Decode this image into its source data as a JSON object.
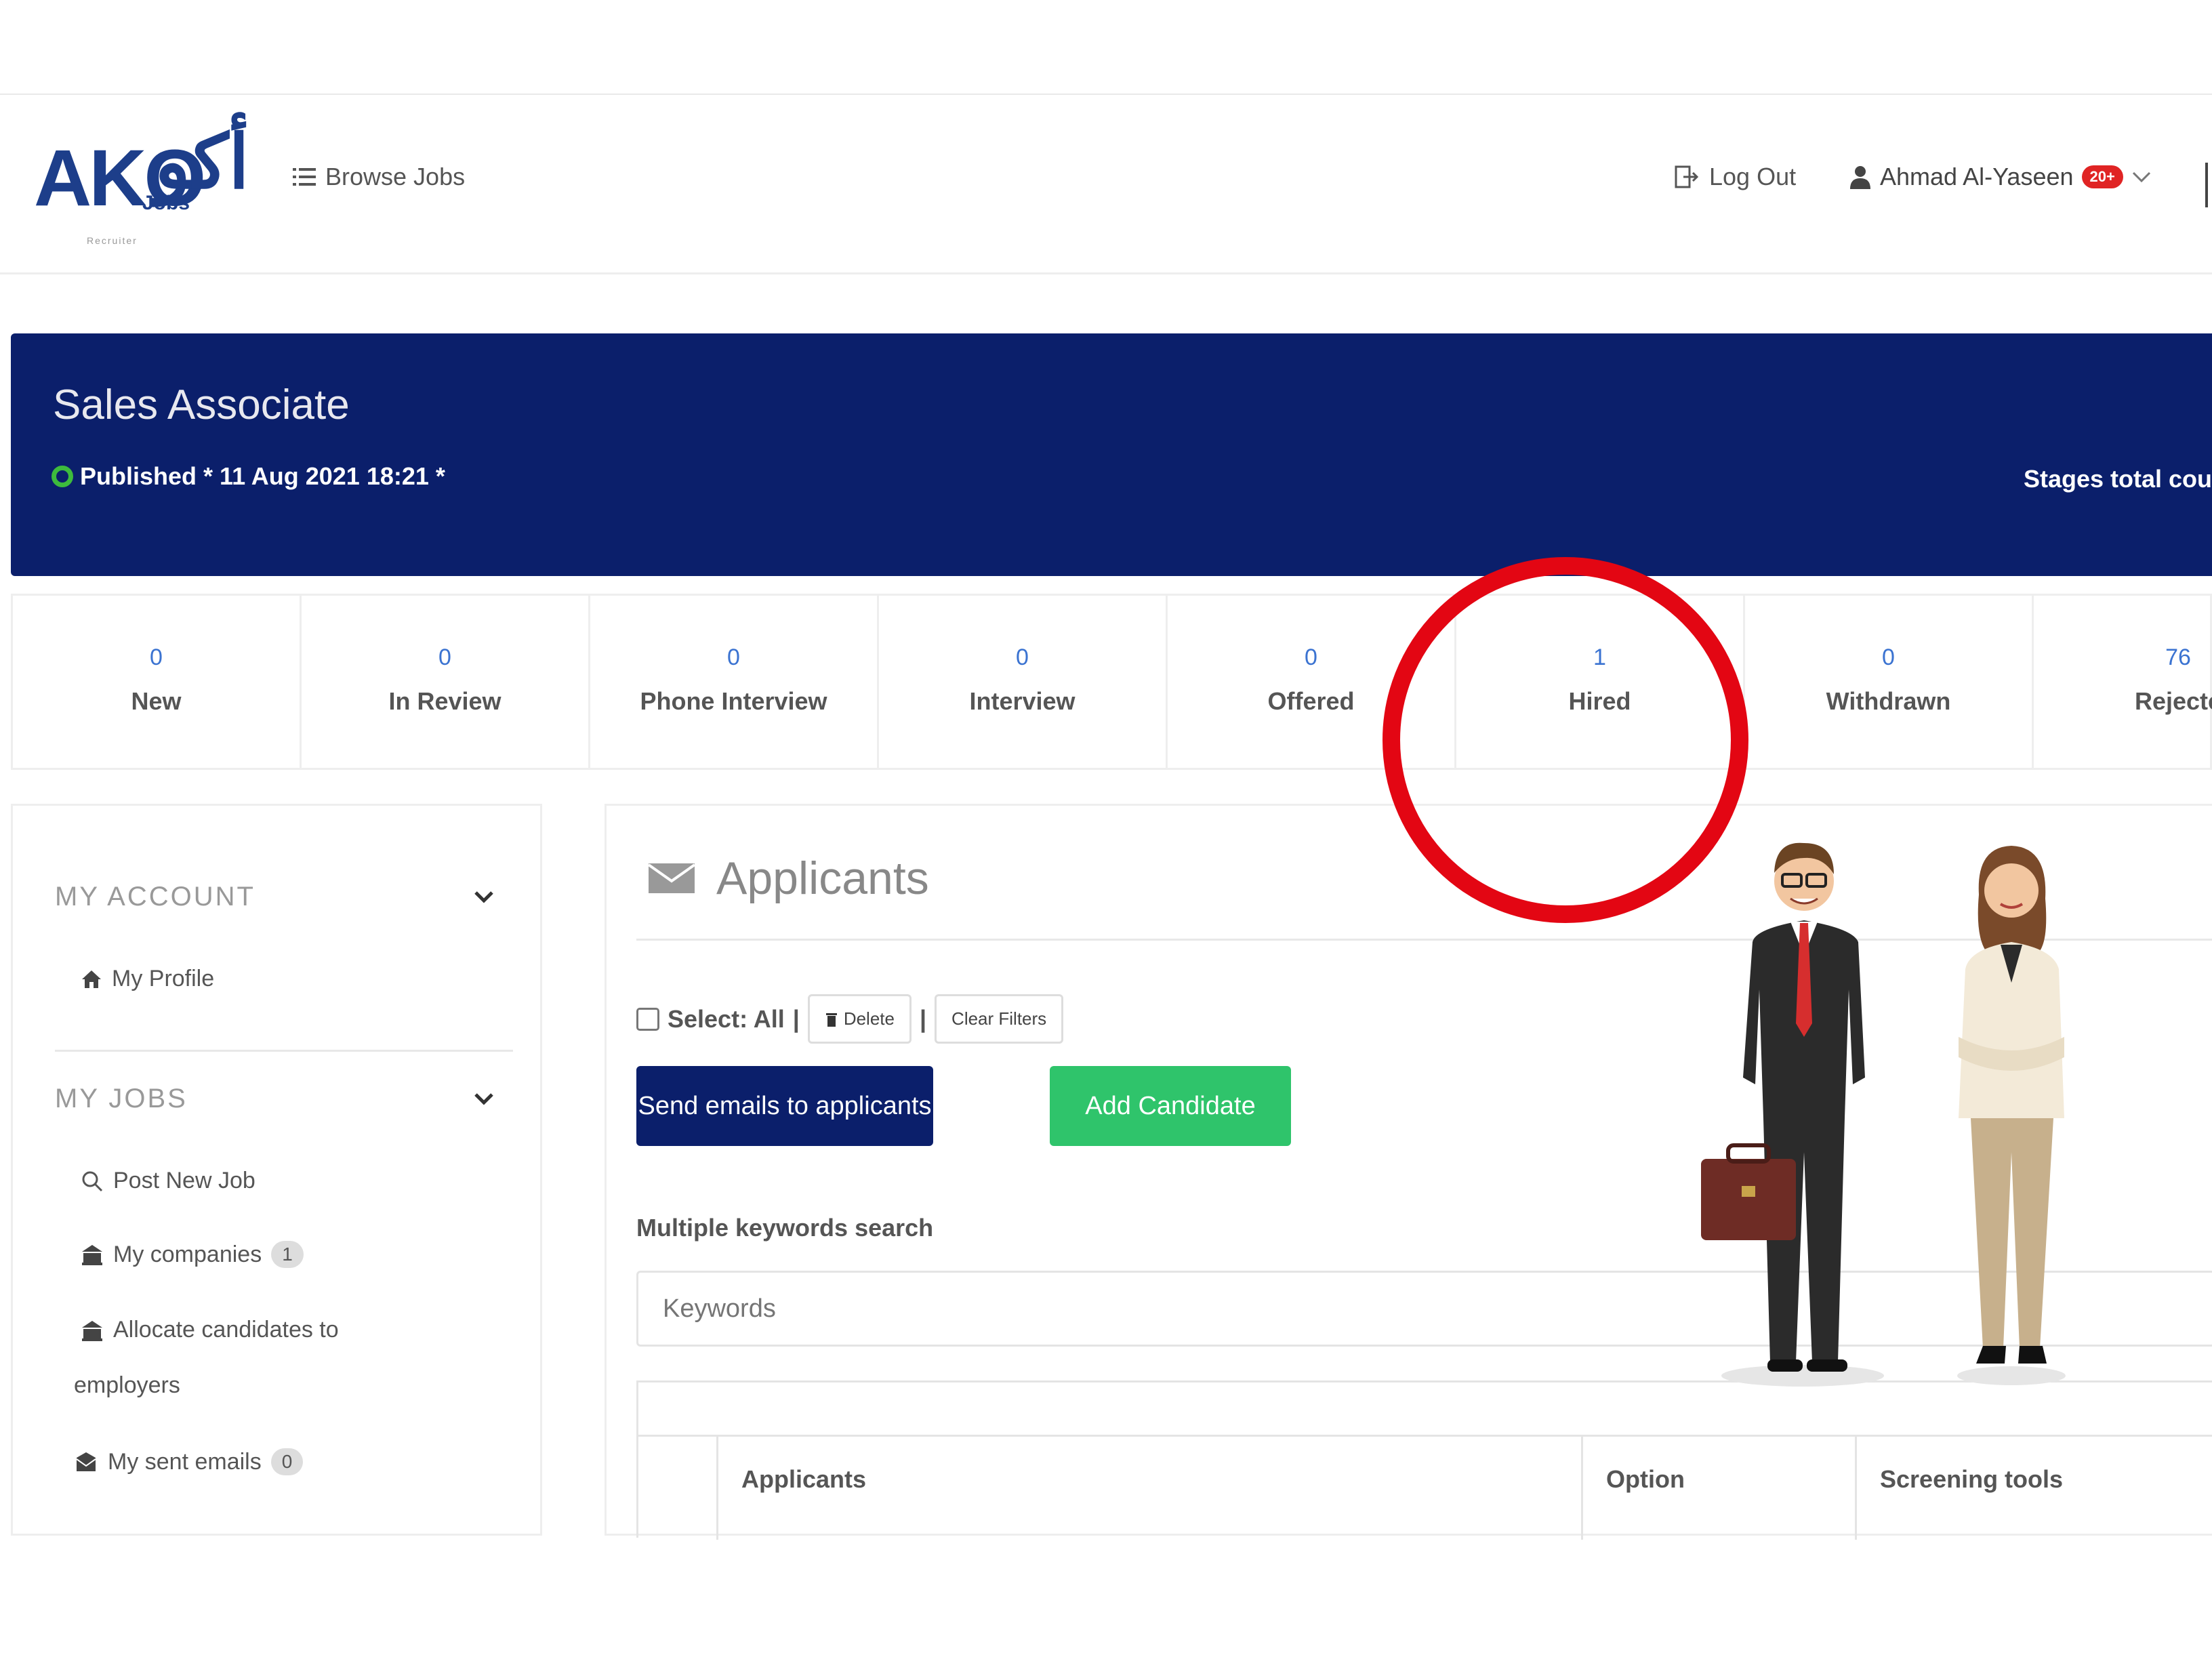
{
  "header": {
    "logo": {
      "latin": "AKO",
      "arabic": "أكو",
      "jobs": "Jobs",
      "subtitle": "Recruiter"
    },
    "browse_jobs": "Browse Jobs",
    "logout": "Log Out",
    "user_name": "Ahmad Al-Yaseen",
    "notif_badge": "20+"
  },
  "job": {
    "title": "Sales Associate",
    "meta": "Published * 11 Aug 2021 18:21 *",
    "stages_total": "Stages total cou"
  },
  "stages": [
    {
      "count": "0",
      "label": "New"
    },
    {
      "count": "0",
      "label": "In Review"
    },
    {
      "count": "0",
      "label": "Phone Interview"
    },
    {
      "count": "0",
      "label": "Interview"
    },
    {
      "count": "0",
      "label": "Offered"
    },
    {
      "count": "1",
      "label": "Hired"
    },
    {
      "count": "0",
      "label": "Withdrawn"
    },
    {
      "count": "76",
      "label": "Rejecte"
    }
  ],
  "sidebar": {
    "account_heading": "MY ACCOUNT",
    "my_profile": "My Profile",
    "jobs_heading": "MY JOBS",
    "post_new_job": "Post New Job",
    "my_companies": "My companies",
    "my_companies_count": "1",
    "allocate_line1": "Allocate candidates to",
    "allocate_line2": "employers",
    "sent_emails": "My sent emails",
    "sent_emails_count": "0"
  },
  "applicants": {
    "title": "Applicants",
    "select_all": "Select: All",
    "delete": "Delete",
    "clear_filters": "Clear Filters",
    "send_emails": "Send emails to applicants",
    "add_candidate": "Add Candidate",
    "keywords_label": "Multiple keywords search",
    "keywords_placeholder": "Keywords",
    "columns": [
      "Applicants",
      "Option",
      "Screening tools"
    ]
  },
  "colors": {
    "brand_navy": "#0b1f6b",
    "add_green": "#2fc46b",
    "highlight_red": "#e30613",
    "count_blue": "#3b73d1"
  }
}
